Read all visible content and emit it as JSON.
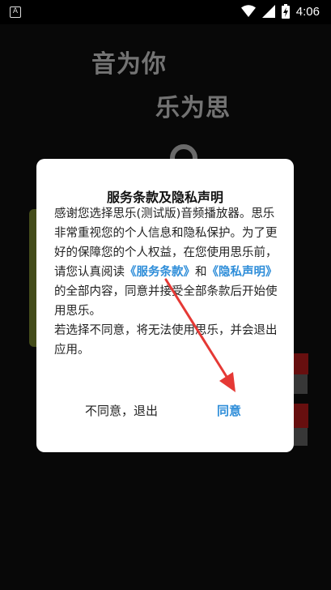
{
  "status_bar": {
    "app_icon_letter": "A",
    "time": "4:06"
  },
  "splash": {
    "line1": "音为你",
    "line2": "乐为思"
  },
  "dialog": {
    "title": "服务条款及隐私声明",
    "body_part1": "感谢您选择思乐(测试版)音频播放器。思乐非常重视您的个人信息和隐私保护。为了更好的保障您的个人权益，在您使用思乐前，请您认真阅读",
    "link_terms": "《服务条款》",
    "and": "和",
    "link_privacy": "《隐私声明》",
    "body_part2": "的全部内容，同意并接受全部条款后开始使用思乐。",
    "body_part3": "若选择不同意，将无法使用思乐，并会退出应用。",
    "btn_disagree": "不同意，退出",
    "btn_agree": "同意"
  },
  "colors": {
    "link": "#2f8ed9",
    "annotation_arrow": "#e53935"
  }
}
